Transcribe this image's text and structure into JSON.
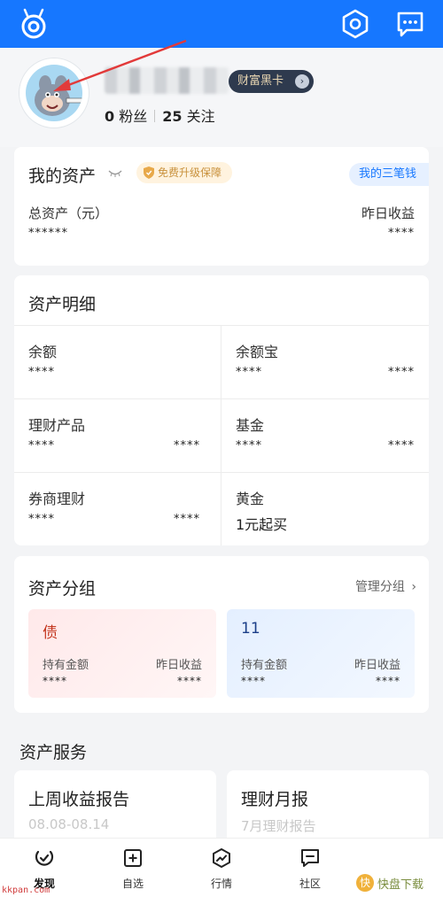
{
  "profile": {
    "black_card_label": "财富黑卡",
    "fans_count": "0",
    "fans_label": "粉丝",
    "follow_count": "25",
    "follow_label": "关注"
  },
  "my_assets": {
    "title": "我的资产",
    "badge": "免费升级保障",
    "three_wallet": "我的三笔钱",
    "total_label": "总资产（元）",
    "total_value": "******",
    "yesterday_label": "昨日收益",
    "yesterday_value": "****"
  },
  "detail": {
    "title": "资产明细",
    "items": [
      {
        "label": "余额",
        "left": "****",
        "right": ""
      },
      {
        "label": "余额宝",
        "left": "****",
        "right": "****"
      },
      {
        "label": "理财产品",
        "left": "****",
        "right": "****"
      },
      {
        "label": "基金",
        "left": "****",
        "right": "****"
      },
      {
        "label": "券商理财",
        "left": "****",
        "right": "****"
      },
      {
        "label": "黄金",
        "left": "1元起买",
        "right": ""
      }
    ]
  },
  "groups": {
    "title": "资产分组",
    "manage_label": "管理分组",
    "items": [
      {
        "name": "债",
        "hold_label": "持有金额",
        "hold_value": "****",
        "yest_label": "昨日收益",
        "yest_value": "****"
      },
      {
        "name": "11",
        "hold_label": "持有金额",
        "hold_value": "****",
        "yest_label": "昨日收益",
        "yest_value": "****"
      }
    ]
  },
  "services": {
    "title": "资产服务",
    "items": [
      {
        "title": "上周收益报告",
        "sub": "08.08-08.14"
      },
      {
        "title": "理财月报",
        "sub": "7月理财报告"
      }
    ]
  },
  "tabbar": {
    "items": [
      {
        "label": "发现",
        "icon": "discover-icon"
      },
      {
        "label": "自选",
        "icon": "add-square-icon"
      },
      {
        "label": "行情",
        "icon": "trend-icon"
      },
      {
        "label": "社区",
        "icon": "chat-square-icon"
      }
    ]
  },
  "watermark": {
    "left_text": "kkpan.com",
    "right_text": "快盘下载"
  },
  "colors": {
    "primary": "#1677ff",
    "black_card_bg": "#2e3a4e",
    "badge_text": "#c8913c",
    "annotation_arrow": "#e23a3a"
  }
}
